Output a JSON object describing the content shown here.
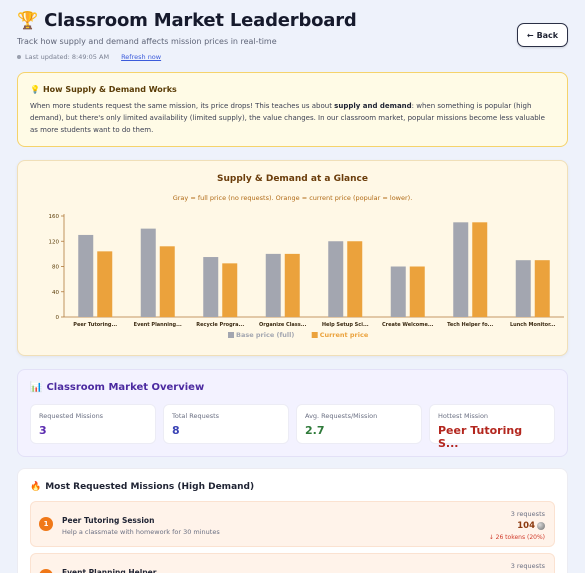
{
  "header": {
    "trophy_icon": "🏆",
    "title": "Classroom Market Leaderboard",
    "subtitle": "Track how supply and demand affects mission prices in real-time",
    "last_updated": "Last updated: 8:49:05 AM",
    "refresh_label": "Refresh now",
    "back_label": "Back",
    "back_icon": "←"
  },
  "info": {
    "icon": "💡",
    "title": "How Supply & Demand Works",
    "body_1": "When more students request the same mission, its price drops! This teaches us about ",
    "body_bold": "supply and demand",
    "body_2": ": when something is popular (high demand), but there's only limited availability (limited supply), the value changes. In our classroom market, popular missions become less valuable as more students want to do them."
  },
  "chart_data": {
    "type": "bar",
    "title": "Supply & Demand at a Glance",
    "subtitle": "Gray = full price (no requests). Orange = current price (popular = lower).",
    "categories": [
      "Peer Tutoring...",
      "Event Planning...",
      "Recycle Progra...",
      "Organize Class...",
      "Help Setup Sci...",
      "Create Welcome...",
      "Tech Helper fo...",
      "Lunch Monitor..."
    ],
    "series": [
      {
        "name": "Base price (full)",
        "color": "#a3a6b0",
        "values": [
          130,
          140,
          95,
          100,
          120,
          80,
          150,
          90
        ]
      },
      {
        "name": "Current price",
        "color": "#eba23c",
        "values": [
          104,
          112,
          85,
          100,
          120,
          80,
          150,
          90
        ]
      }
    ],
    "yticks": [
      0,
      40,
      80,
      120,
      160
    ],
    "ylim": [
      0,
      160
    ],
    "grid": false,
    "legend": "bottom"
  },
  "overview": {
    "icon": "📊",
    "title": "Classroom Market Overview",
    "stats": [
      {
        "label": "Requested Missions",
        "value": "3",
        "color": "#5b2bb0"
      },
      {
        "label": "Total Requests",
        "value": "8",
        "color": "#3a43b5"
      },
      {
        "label": "Avg. Requests/Mission",
        "value": "2.7",
        "color": "#2f7a3a"
      },
      {
        "label": "Hottest Mission",
        "value": "Peer Tutoring S...",
        "color": "#b3261e"
      }
    ]
  },
  "demand": {
    "icon": "🔥",
    "title": "Most Requested Missions (High Demand)",
    "missions": [
      {
        "rank": "1",
        "name": "Peer Tutoring Session",
        "desc": "Help a classmate with homework for 30 minutes",
        "requests": "3 requests",
        "price": "104",
        "drop": "↓ 26 tokens (20%)"
      },
      {
        "rank": "2",
        "name": "Event Planning Helper",
        "desc": "",
        "requests": "3 requests",
        "price": "",
        "drop": ""
      }
    ]
  }
}
